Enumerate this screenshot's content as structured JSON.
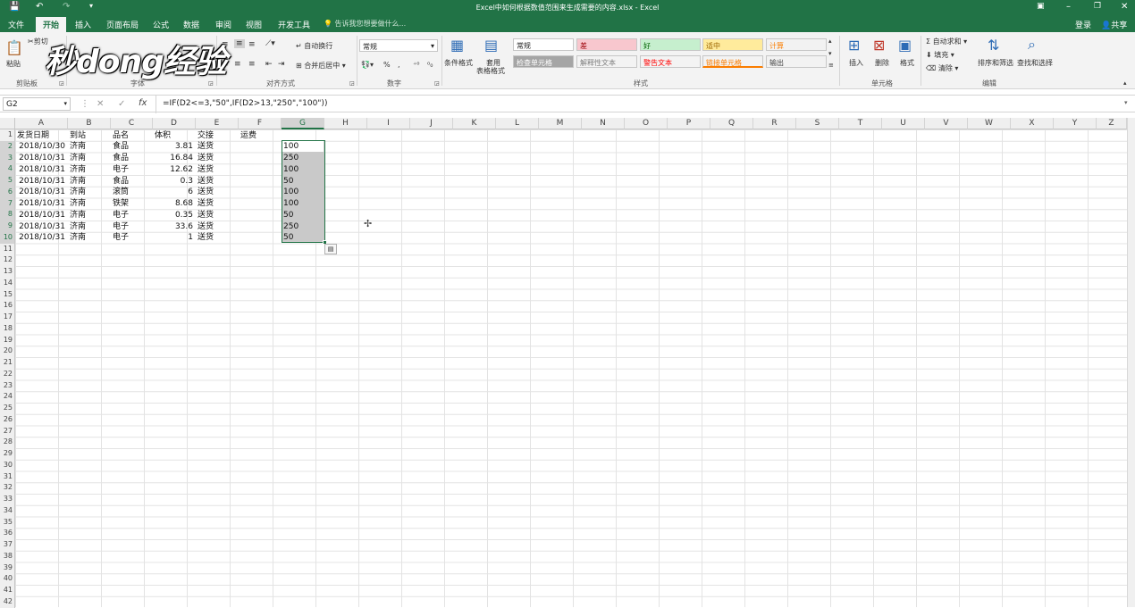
{
  "window": {
    "title": "Excel中如何根据数值范围来生成需要的内容.xlsx - Excel",
    "save_icon": "save-icon",
    "undo_icon": "undo-icon",
    "redo_icon": "redo-icon"
  },
  "menubar": {
    "tabs": [
      "文件",
      "开始",
      "插入",
      "页面布局",
      "公式",
      "数据",
      "审阅",
      "视图",
      "开发工具"
    ],
    "tell_me": "告诉我您想要做什么...",
    "login": "登录",
    "share": "共享"
  },
  "ribbon": {
    "clipboard": {
      "paste": "粘贴",
      "cut": "剪切",
      "label": "剪贴板"
    },
    "font": {
      "label": "字体"
    },
    "align": {
      "wrap": "自动换行",
      "merge": "合并后居中",
      "label": "对齐方式"
    },
    "number": {
      "format": "常规",
      "percent": "%",
      "comma": ",",
      "label": "数字"
    },
    "styles": {
      "conditional": "条件格式",
      "table": "套用",
      "table2": "表格格式",
      "cells": [
        {
          "text": "常规",
          "bg": "#ffffff",
          "color": "#222222"
        },
        {
          "text": "差",
          "bg": "#f8c7ce",
          "color": "#9c0006"
        },
        {
          "text": "好",
          "bg": "#c6efce",
          "color": "#006100"
        },
        {
          "text": "适中",
          "bg": "#ffeb9c",
          "color": "#9c6500"
        },
        {
          "text": "计算",
          "bg": "#f2f2f2",
          "color": "#fa7d00"
        },
        {
          "text": "检查单元格",
          "bg": "#a5a5a5",
          "color": "#ffffff"
        },
        {
          "text": "解释性文本",
          "bg": "#f3f3f3",
          "color": "#7f7f7f"
        },
        {
          "text": "警告文本",
          "bg": "#f3f3f3",
          "color": "#ff0000"
        },
        {
          "text": "链接单元格",
          "bg": "#f3f3f3",
          "color": "#fa7d00"
        },
        {
          "text": "输出",
          "bg": "#f2f2f2",
          "color": "#3f3f3f"
        }
      ],
      "label": "样式"
    },
    "cells": {
      "insert": "插入",
      "delete": "删除",
      "format": "格式",
      "label": "单元格"
    },
    "editing": {
      "autosum": "自动求和",
      "fill": "填充",
      "clear": "清除",
      "sort": "排序和筛选",
      "find": "查找和选择",
      "label": "编辑"
    }
  },
  "watermark": "秒dong经验",
  "formula_bar": {
    "name_box": "G2",
    "cancel": "✕",
    "enter": "✓",
    "fx": "fx",
    "formula": "=IF(D2<=3,\"50\",IF(D2>13,\"250\",\"100\"))"
  },
  "columns": [
    "A",
    "B",
    "C",
    "D",
    "E",
    "F",
    "G",
    "H",
    "I",
    "J",
    "K",
    "L",
    "M",
    "N",
    "O",
    "P",
    "Q",
    "R",
    "S",
    "T",
    "U",
    "V",
    "W",
    "X",
    "Y",
    "Z"
  ],
  "headers": [
    "发货日期",
    "到站",
    "品名",
    "体积",
    "交接",
    "运费"
  ],
  "rows": [
    [
      "2018/10/30",
      "济南",
      "食品",
      "3.81",
      "送货",
      "",
      "100"
    ],
    [
      "2018/10/31",
      "济南",
      "食品",
      "16.84",
      "送货",
      "",
      "250"
    ],
    [
      "2018/10/31",
      "济南",
      "电子",
      "12.62",
      "送货",
      "",
      "100"
    ],
    [
      "2018/10/31",
      "济南",
      "食品",
      "0.3",
      "送货",
      "",
      "50"
    ],
    [
      "2018/10/31",
      "济南",
      "滚筒",
      "6",
      "送货",
      "",
      "100"
    ],
    [
      "2018/10/31",
      "济南",
      "铁架",
      "8.68",
      "送货",
      "",
      "100"
    ],
    [
      "2018/10/31",
      "济南",
      "电子",
      "0.35",
      "送货",
      "",
      "50"
    ],
    [
      "2018/10/31",
      "济南",
      "电子",
      "33.6",
      "送货",
      "",
      "250"
    ],
    [
      "2018/10/31",
      "济南",
      "电子",
      "1",
      "送货",
      "",
      "50"
    ]
  ],
  "row_count": 42
}
